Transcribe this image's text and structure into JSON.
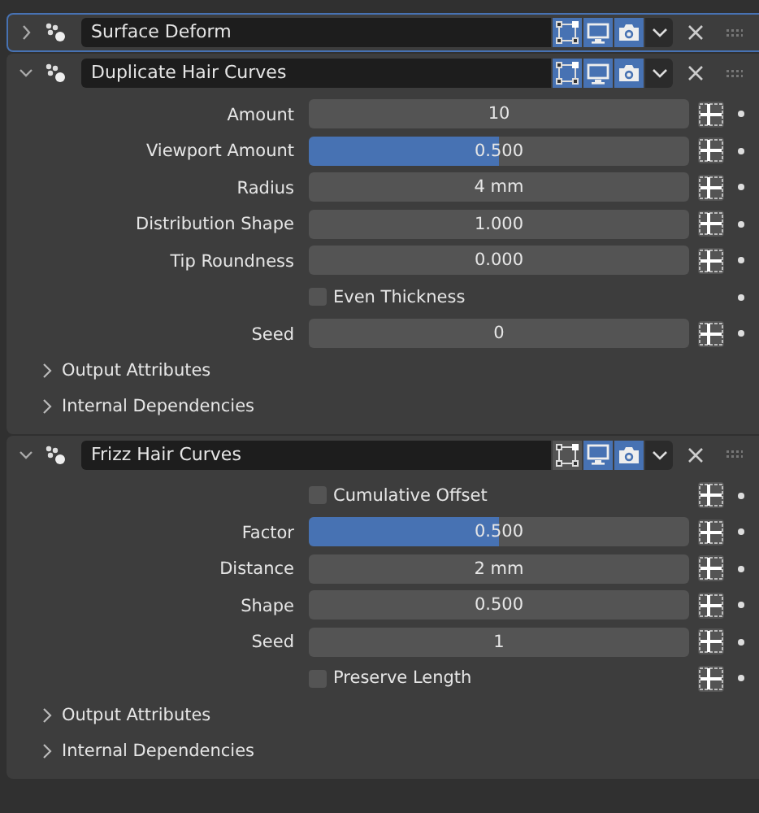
{
  "modifiers": [
    {
      "name": "Surface Deform",
      "expanded": false,
      "active": true,
      "toggles": [
        {
          "kind": "edit",
          "on": true
        },
        {
          "kind": "viewport",
          "on": true
        },
        {
          "kind": "render",
          "on": true
        }
      ]
    },
    {
      "name": "Duplicate Hair Curves",
      "expanded": true,
      "active": false,
      "toggles": [
        {
          "kind": "edit",
          "on": true
        },
        {
          "kind": "viewport",
          "on": true
        },
        {
          "kind": "render",
          "on": true
        }
      ],
      "rows": [
        {
          "kind": "number",
          "label": "Amount",
          "value": "10"
        },
        {
          "kind": "slider",
          "label": "Viewport Amount",
          "value": "0.500",
          "level": 0.5
        },
        {
          "kind": "number",
          "label": "Radius",
          "value": "4 mm"
        },
        {
          "kind": "number",
          "label": "Distribution Shape",
          "value": "1.000"
        },
        {
          "kind": "number",
          "label": "Tip Roundness",
          "value": "0.000"
        },
        {
          "kind": "checkbox",
          "label": "Even Thickness",
          "checked": false
        },
        {
          "kind": "number",
          "label": "Seed",
          "value": "0"
        }
      ],
      "subpanels": [
        {
          "label": "Output Attributes",
          "expanded": false
        },
        {
          "label": "Internal Dependencies",
          "expanded": false
        }
      ]
    },
    {
      "name": "Frizz Hair Curves",
      "expanded": true,
      "active": false,
      "toggles": [
        {
          "kind": "edit",
          "on": false
        },
        {
          "kind": "viewport",
          "on": true
        },
        {
          "kind": "render",
          "on": true
        }
      ],
      "rows": [
        {
          "kind": "checkbox",
          "label": "Cumulative Offset",
          "checked": false
        },
        {
          "kind": "slider",
          "label": "Factor",
          "value": "0.500",
          "level": 0.5
        },
        {
          "kind": "number",
          "label": "Distance",
          "value": "2 mm"
        },
        {
          "kind": "number",
          "label": "Shape",
          "value": "0.500"
        },
        {
          "kind": "number",
          "label": "Seed",
          "value": "1"
        },
        {
          "kind": "checkbox",
          "label": "Preserve Length",
          "checked": false
        }
      ],
      "subpanels": [
        {
          "label": "Output Attributes",
          "expanded": false
        },
        {
          "label": "Internal Dependencies",
          "expanded": false
        }
      ]
    }
  ]
}
